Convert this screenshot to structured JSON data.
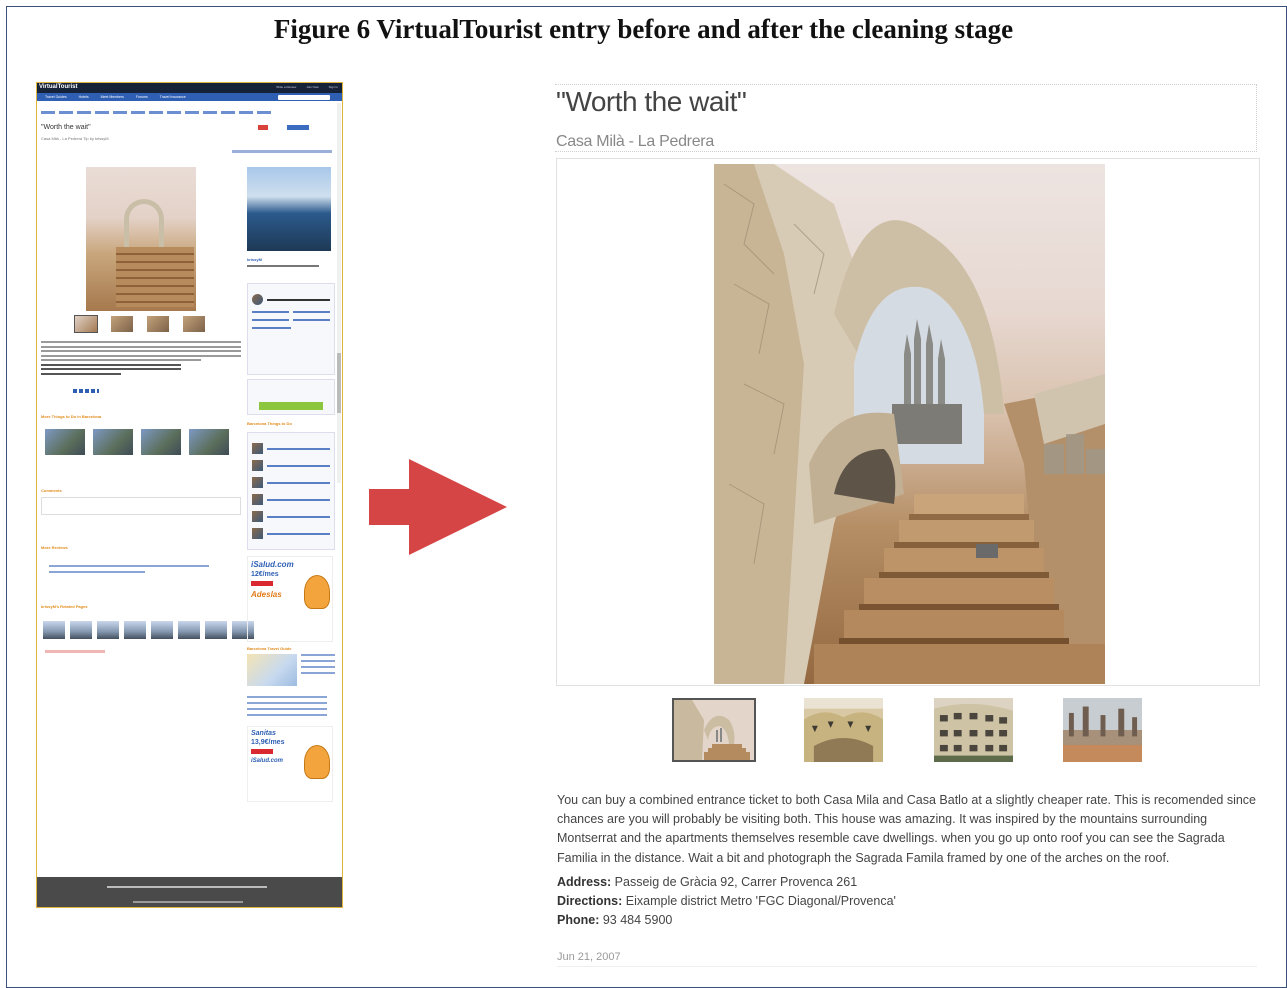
{
  "figure": {
    "title": "Figure 6 VirtualTourist entry before and after the cleaning stage"
  },
  "before_page": {
    "site_logo": "VirtualTourist",
    "nav": [
      "Travel Guides",
      "Hotels",
      "Meet Members",
      "Forums",
      "Travel Insurance"
    ],
    "top_links": [
      "Write a Review",
      "Join Now",
      "Sign In"
    ],
    "entry_title": "\"Worth the wait\"",
    "entry_subtitle": "Casa Milà - La Pedrera Tip by krissyM",
    "username": "krissyM",
    "share_button": "Share Your Travels",
    "sections": {
      "more_things": "More Things to Do in Barcelona",
      "comments": "Comments",
      "more_reviews": "More Reviews",
      "related_pages": "krissyM's Related Pages",
      "things_to_do": "Barcelona Things to Do",
      "travel_guide": "Barcelona Travel Guide"
    },
    "ads": [
      {
        "brand": "iSalud.com",
        "price": "12€/mes",
        "sub": "Adeslas"
      },
      {
        "brand": "Sanitas",
        "price": "13,9€/mes",
        "sub": "iSalud.com"
      }
    ]
  },
  "after_page": {
    "title": "\"Worth the wait\"",
    "subtitle": "Casa Milà - La Pedrera",
    "description": "You can buy a combined entrance ticket to both Casa Mila and Casa Batlo at a slightly cheaper rate. This is recomended since chances are you will probably be visiting both. This house was amazing. It was inspired by the mountains surrounding Montserrat and the apartments themselves resemble cave dwellings. when you go up onto roof you can see the Sagrada Familia in the distance. Wait a bit and photograph the Sagrada Famila framed by one of the arches on the roof.",
    "address_label": "Address:",
    "address": "Passeig de Gràcia 92, Carrer Provenca 261",
    "directions_label": "Directions:",
    "directions": "Eixample district Metro 'FGC Diagonal/Provenca'",
    "phone_label": "Phone:",
    "phone": "93 484 5900",
    "date": "Jun 21, 2007",
    "thumbnails": [
      "rooftop-arch",
      "facade-balconies",
      "building-exterior",
      "rooftop-chimneys"
    ],
    "selected_thumbnail": 0
  },
  "colors": {
    "arrow": "#d64545",
    "left_border": "#e1b43b",
    "frame_border": "#3a4f7a",
    "site_header": "#152238",
    "site_nav": "#2e5fb3"
  }
}
